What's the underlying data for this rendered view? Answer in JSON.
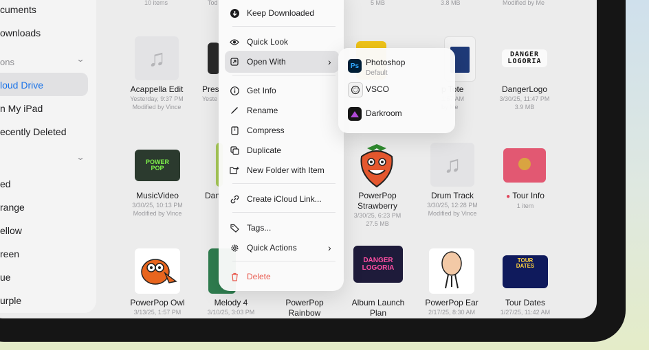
{
  "sidebar": {
    "items": [
      {
        "label": "cuments"
      },
      {
        "label": "ownloads"
      },
      {
        "label": "ons"
      },
      {
        "label": "loud Drive"
      },
      {
        "label": "n My iPad"
      },
      {
        "label": "ecently Deleted"
      },
      {
        "label": "ed"
      },
      {
        "label": "range"
      },
      {
        "label": "ellow"
      },
      {
        "label": "reen"
      },
      {
        "label": "ue"
      },
      {
        "label": "urple"
      }
    ],
    "chevron": "⌄"
  },
  "top_meta": {
    "a": "10 items",
    "b": "Tod",
    "c": "5 MB",
    "d": "3.8 MB",
    "e": "Modified by Me"
  },
  "files": [
    {
      "name": "Acappella Edit",
      "meta1": "Yesterday, 9:37 PM",
      "meta2": "Modified by Vince"
    },
    {
      "name": "Pres",
      "meta1": "Yeste"
    },
    {
      "name": "p Tote",
      "meta1": "1:57 AM",
      "meta2": "by Me"
    },
    {
      "name": "DangerLogo",
      "meta1": "3/30/25, 11:47 PM",
      "meta2": "3.9 MB"
    },
    {
      "name": "MusicVideo",
      "meta1": "3/30/25, 10:13 PM",
      "meta2": "Modified by Vince"
    },
    {
      "name": "Dan"
    },
    {
      "name": "PowerPop Strawberry",
      "line2": "Strawberry",
      "meta1": "3/30/25, 6:23 PM",
      "meta2": "27.5 MB"
    },
    {
      "name": "Drum Track",
      "meta1": "3/30/25, 12:28 PM",
      "meta2": "Modified by Vince"
    },
    {
      "name": "Tour Info",
      "meta1": "1 item"
    },
    {
      "name": "PowerPop Owl",
      "meta1": "3/13/25, 1:57 PM"
    },
    {
      "name": "Melody 4",
      "meta1": "3/10/25, 3:03 PM"
    },
    {
      "name": "PowerPop",
      "line2": "Rainbow"
    },
    {
      "name": "Album Launch",
      "line2": "Plan"
    },
    {
      "name": "PowerPop Ear",
      "meta1": "2/17/25, 8:30 AM"
    },
    {
      "name": "Tour Dates",
      "meta1": "1/27/25, 11:42 AM"
    }
  ],
  "thumb_text": {
    "danger_logo": "DANGER\nLOGORIA",
    "power_pop": "POWER\nPOP",
    "tour": "TOUR\nDATES",
    "danger_album": "DANGER\nLOGORIA"
  },
  "menu": {
    "items": [
      {
        "label": "Keep Downloaded",
        "icon": "download-icon"
      },
      {
        "label": "Quick Look",
        "icon": "eye-icon"
      },
      {
        "label": "Open With",
        "icon": "open-with-icon"
      },
      {
        "label": "Get Info",
        "icon": "info-icon"
      },
      {
        "label": "Rename",
        "icon": "pencil-icon"
      },
      {
        "label": "Compress",
        "icon": "archive-icon"
      },
      {
        "label": "Duplicate",
        "icon": "duplicate-icon"
      },
      {
        "label": "New Folder with Item",
        "icon": "folder-plus-icon"
      },
      {
        "label": "Create iCloud Link...",
        "icon": "link-icon"
      },
      {
        "label": "Tags...",
        "icon": "tag-icon"
      },
      {
        "label": "Quick Actions",
        "icon": "gear-icon"
      },
      {
        "label": "Delete",
        "icon": "trash-icon"
      }
    ]
  },
  "submenu": {
    "items": [
      {
        "label": "Photoshop",
        "sub": "Default",
        "icon_text": "Ps",
        "icon": "photoshop-icon"
      },
      {
        "label": "VSCO",
        "icon": "vsco-icon"
      },
      {
        "label": "Darkroom",
        "icon": "darkroom-icon"
      }
    ]
  },
  "colors": {
    "accent": "#1a73e8",
    "danger": "#e8584c",
    "tag_red": "#e0445a",
    "folder_pink": "#e25872",
    "folder_yellow": "#f0c419"
  }
}
